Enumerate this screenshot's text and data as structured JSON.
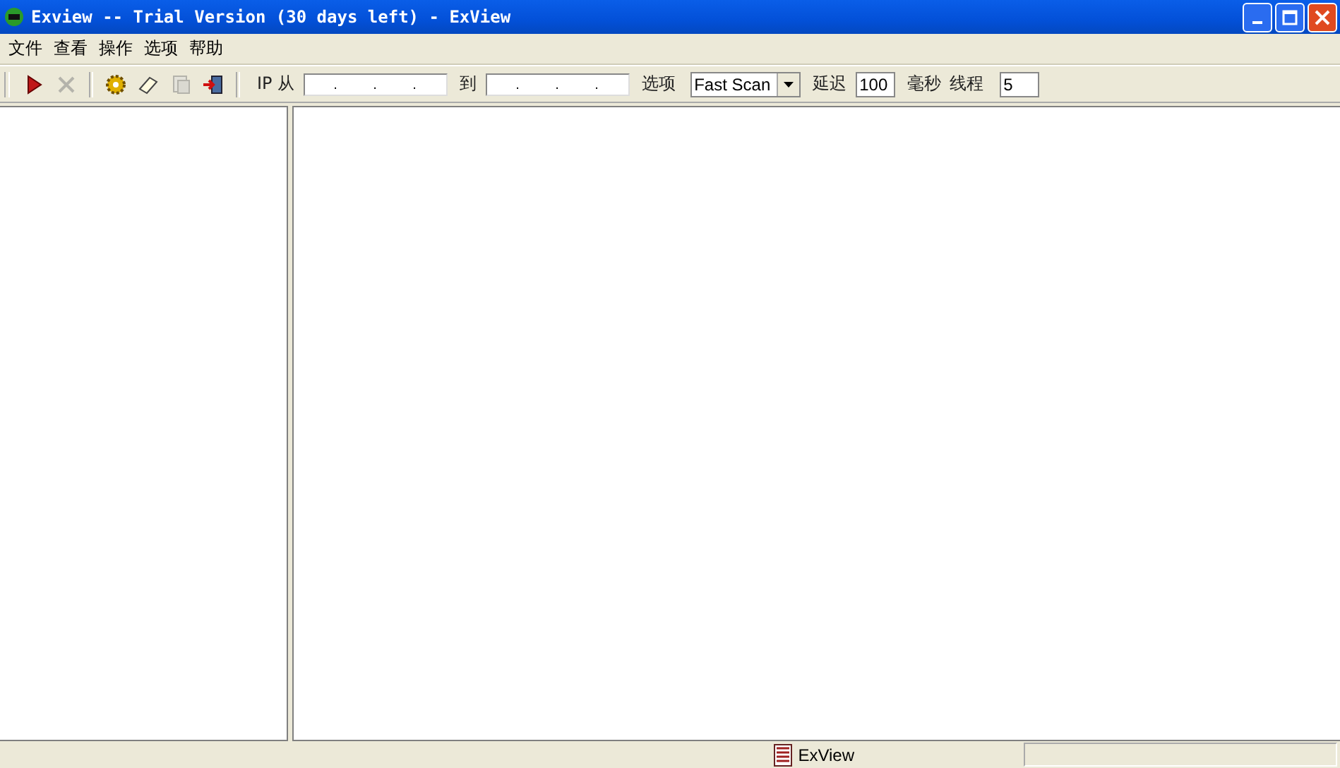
{
  "window": {
    "title": "Exview -- Trial Version (30 days left) - ExView"
  },
  "menu": [
    "文件",
    "查看",
    "操作",
    "选项",
    "帮助"
  ],
  "toolbar": {
    "tools": [
      {
        "kind": "play",
        "disabled": false
      },
      {
        "kind": "stop",
        "disabled": true
      },
      {
        "kind": "gear",
        "disabled": false
      },
      {
        "kind": "eraser",
        "disabled": false
      },
      {
        "kind": "copy",
        "disabled": true
      },
      {
        "kind": "exit",
        "disabled": false
      }
    ],
    "ip_from_label": "IP 从",
    "ip_from_separators": [
      ".",
      ".",
      "."
    ],
    "ip_to_label": "到",
    "ip_to_separators": [
      ".",
      ".",
      "."
    ],
    "option_label": "选项",
    "option_value": "Fast Scan",
    "delay_label": "延迟",
    "delay_value": "100",
    "delay_unit": "毫秒",
    "threads_label": "线程",
    "threads_value": "5"
  },
  "status_bar": {
    "text": "ExView"
  }
}
